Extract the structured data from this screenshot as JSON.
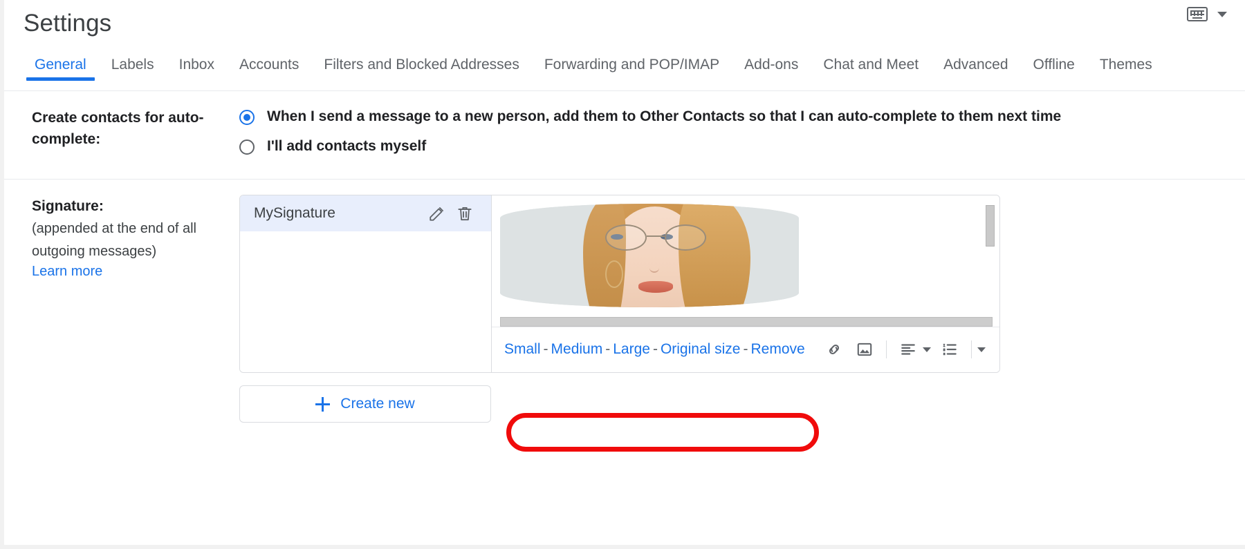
{
  "header": {
    "title": "Settings",
    "keyboard_icon": "keyboard-icon",
    "caret_icon": "chevron-down-icon"
  },
  "tabs": [
    {
      "label": "General",
      "active": true
    },
    {
      "label": "Labels",
      "active": false
    },
    {
      "label": "Inbox",
      "active": false
    },
    {
      "label": "Accounts",
      "active": false
    },
    {
      "label": "Filters and Blocked Addresses",
      "active": false
    },
    {
      "label": "Forwarding and POP/IMAP",
      "active": false
    },
    {
      "label": "Add-ons",
      "active": false
    },
    {
      "label": "Chat and Meet",
      "active": false
    },
    {
      "label": "Advanced",
      "active": false
    },
    {
      "label": "Offline",
      "active": false
    },
    {
      "label": "Themes",
      "active": false
    }
  ],
  "autocomplete": {
    "label": "Create contacts for auto-complete:",
    "options": [
      {
        "label": "When I send a message to a new person, add them to Other Contacts so that I can auto-complete to them next time",
        "selected": true
      },
      {
        "label": "I'll add contacts myself",
        "selected": false
      }
    ]
  },
  "signature": {
    "label": "Signature:",
    "sublabel_line1": "(appended at the end of all",
    "sublabel_line2": "outgoing messages)",
    "learn_more": "Learn more",
    "items": [
      {
        "name": "MySignature",
        "selected": true
      }
    ],
    "edit_icon": "pencil-icon",
    "delete_icon": "trash-icon",
    "create_new": "Create new",
    "plus_icon": "plus-icon",
    "image_size_links": {
      "small": "Small",
      "medium": "Medium",
      "large": "Large",
      "original": "Original size",
      "remove": "Remove",
      "separator": "-"
    },
    "toolbar_icons": [
      "link-icon",
      "insert-image-icon",
      "align-icon",
      "align-dropdown-caret-icon",
      "numbered-list-icon",
      "more-options-caret-icon"
    ],
    "scrollbars": {
      "vertical": "vertical-scrollbar",
      "horizontal": "horizontal-scrollbar"
    }
  },
  "colors": {
    "accent_blue": "#1a73e8",
    "text_primary": "#202124",
    "text_secondary": "#5f6368",
    "selected_row_bg": "#e8eefc",
    "border": "#dadce0",
    "annotation_red": "#f00b0b"
  }
}
